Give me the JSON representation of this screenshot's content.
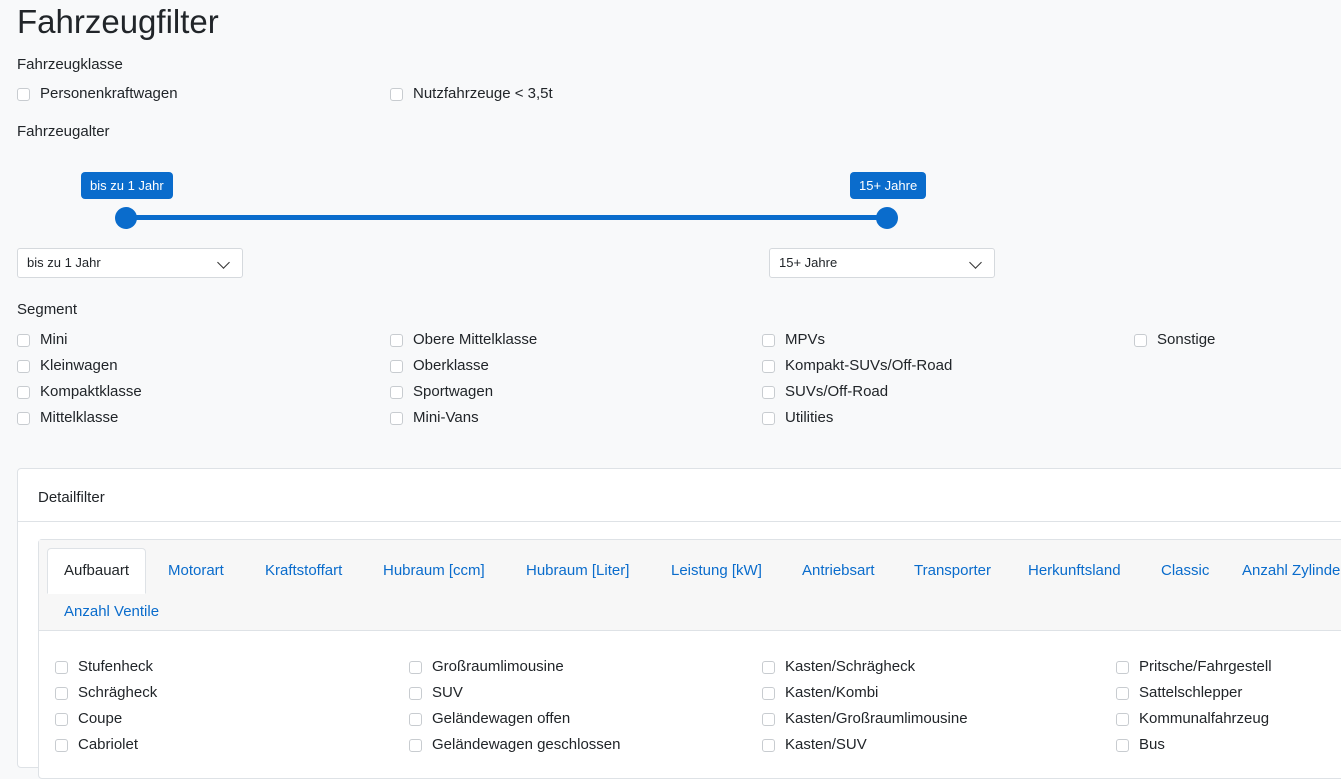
{
  "title": "Fahrzeugfilter",
  "fahrzeugklasse": {
    "label": "Fahrzeugklasse",
    "options": [
      "Personenkraftwagen",
      "Nutzfahrzeuge < 3,5t"
    ]
  },
  "fahrzeugalter": {
    "label": "Fahrzeugalter",
    "slider": {
      "min_label": "bis zu 1 Jahr",
      "max_label": "15+ Jahre",
      "min_fraction": 0.0,
      "max_fraction": 1.0
    },
    "select_from": "bis zu 1 Jahr",
    "select_to": "15+ Jahre"
  },
  "segment": {
    "label": "Segment",
    "col1": [
      "Mini",
      "Kleinwagen",
      "Kompaktklasse",
      "Mittelklasse"
    ],
    "col2": [
      "Obere Mittelklasse",
      "Oberklasse",
      "Sportwagen",
      "Mini-Vans"
    ],
    "col3": [
      "MPVs",
      "Kompakt-SUVs/Off-Road",
      "SUVs/Off-Road",
      "Utilities"
    ],
    "col4": [
      "Sonstige"
    ]
  },
  "detailfilter": {
    "title": "Detailfilter",
    "tabs": [
      "Aufbauart",
      "Motorart",
      "Kraftstoffart",
      "Hubraum [ccm]",
      "Hubraum [Liter]",
      "Leistung [kW]",
      "Antriebsart",
      "Transporter",
      "Herkunftsland",
      "Classic",
      "Anzahl Zylinder",
      "Anzahl Ventile"
    ],
    "aufbauart": {
      "col1": [
        "Stufenheck",
        "Schrägheck",
        "Coupe",
        "Cabriolet"
      ],
      "col2": [
        "Großraumlimousine",
        "SUV",
        "Geländewagen offen",
        "Geländewagen geschlossen"
      ],
      "col3": [
        "Kasten/Schrägheck",
        "Kasten/Kombi",
        "Kasten/Großraumlimousine",
        "Kasten/SUV"
      ],
      "col4": [
        "Pritsche/Fahrgestell",
        "Sattelschlepper",
        "Kommunalfahrzeug",
        "Bus"
      ]
    }
  },
  "colors": {
    "accent": "#0a6ccc",
    "link": "#0a6ccc"
  }
}
